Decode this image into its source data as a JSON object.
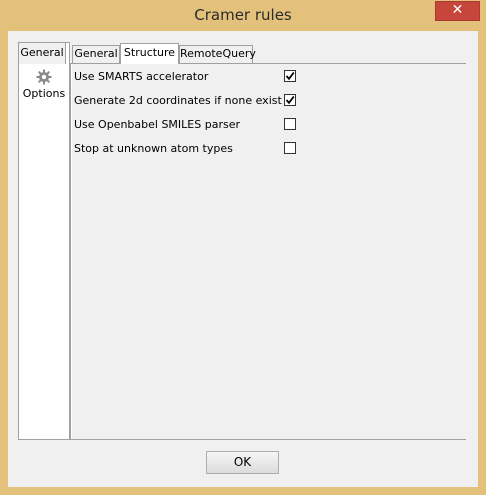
{
  "window": {
    "title": "Cramer rules",
    "close_label": "✕"
  },
  "sidebar": {
    "tab_label": "General",
    "items": [
      {
        "label": "Options",
        "icon": "gear-icon"
      }
    ]
  },
  "tabs": [
    {
      "label": "General",
      "selected": false
    },
    {
      "label": "Structure",
      "selected": true
    },
    {
      "label": "RemoteQuery",
      "selected": false
    }
  ],
  "options": [
    {
      "label": "Use SMARTS accelerator",
      "checked": true
    },
    {
      "label": "Generate 2d coordinates if none exist",
      "checked": true
    },
    {
      "label": "Use Openbabel SMILES parser",
      "checked": false
    },
    {
      "label": "Stop at unknown atom types",
      "checked": false
    }
  ],
  "footer": {
    "ok_label": "OK"
  }
}
